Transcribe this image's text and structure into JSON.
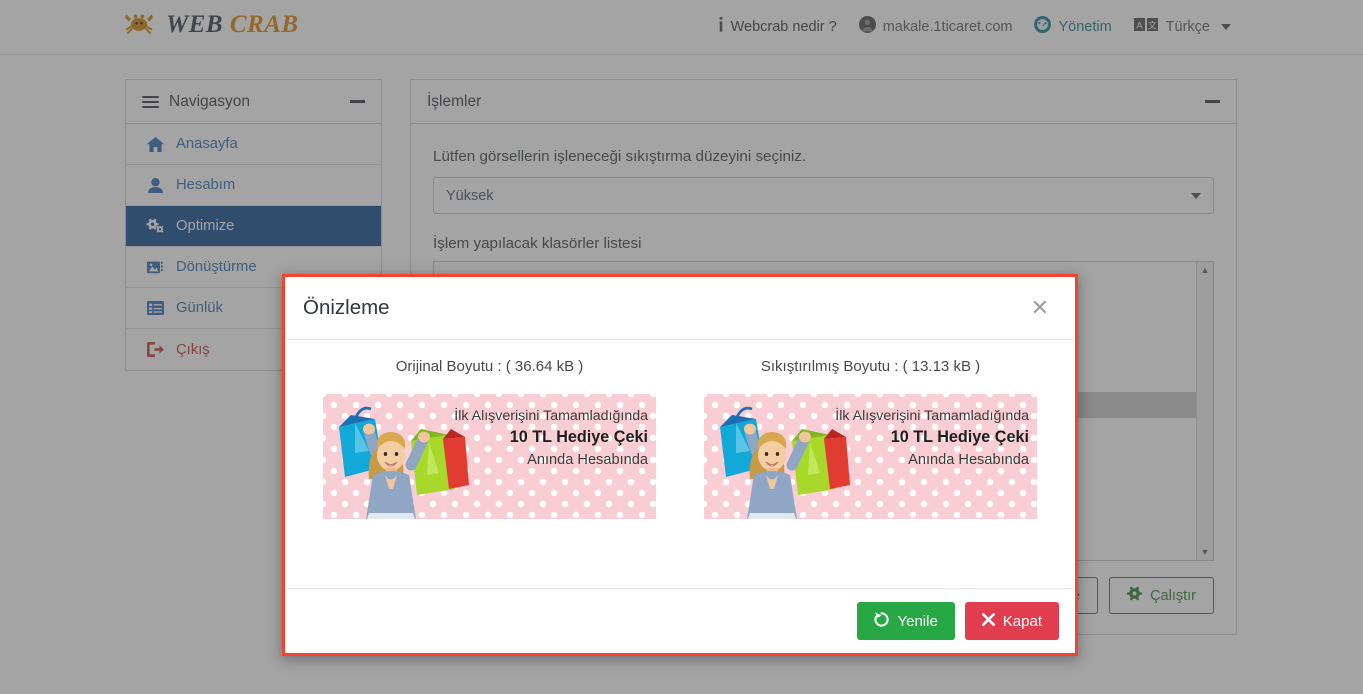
{
  "header": {
    "brand": {
      "word1": "WEB",
      "word2": "CRAB",
      "icon": "crab-icon"
    },
    "nav": [
      {
        "label": "Webcrab nedir ?",
        "icon": "info-icon",
        "style": "link"
      },
      {
        "label": "makale.1ticaret.com",
        "icon": "user-circle-icon",
        "style": "muted"
      },
      {
        "label": "Yönetim",
        "icon": "dashboard-icon",
        "style": "teal"
      },
      {
        "label": "Türkçe",
        "icon": "language-icon",
        "style": "muted",
        "caret": true
      }
    ]
  },
  "sidebar": {
    "title": "Navigasyon",
    "collapse_icon": "minus-icon",
    "menu_icon": "hamburger-icon",
    "items": [
      {
        "label": "Anasayfa",
        "icon": "home-icon",
        "active": false
      },
      {
        "label": "Hesabım",
        "icon": "user-icon",
        "active": false
      },
      {
        "label": "Optimize",
        "icon": "cogs-icon",
        "active": true
      },
      {
        "label": "Dönüştürme",
        "icon": "images-icon",
        "active": false
      },
      {
        "label": "Günlük",
        "icon": "list-alt-icon",
        "active": false
      },
      {
        "label": "Çıkış",
        "icon": "sign-out-icon",
        "active": false,
        "logout": true
      }
    ]
  },
  "main": {
    "title": "İşlemler",
    "collapse_icon": "minus-icon",
    "compression_help": "Lütfen görsellerin işleneceği sıkıştırma düzeyini seçiniz.",
    "compression_value": "Yüksek",
    "compression_caret": "chevron-down-icon",
    "folders_label": "İşlem yapılacak klasörler listesi",
    "scroll_up_icon": "triangle-up-icon",
    "scroll_down_icon": "triangle-down-icon",
    "buttons": [
      {
        "label": "Önizleme",
        "icon": "eye-icon"
      },
      {
        "label": "Çalıştır",
        "icon": "gear-icon"
      }
    ]
  },
  "modal": {
    "title": "Önizleme",
    "close_icon": "close-icon",
    "original": {
      "caption": "Orijinal Boyutu : ( 36.64 kB )",
      "banner": {
        "line1": "İlk Alışverişini Tamamladığında",
        "line2": "10 TL Hediye Çeki",
        "line3": "Anında Hesabında"
      }
    },
    "compressed": {
      "caption": "Sıkıştırılmış Boyutu : ( 13.13 kB )",
      "banner": {
        "line1": "İlk Alışverişini Tamamladığında",
        "line2": "10 TL Hediye Çeki",
        "line3": "Anında Hesabında"
      }
    },
    "buttons": [
      {
        "label": "Yenile",
        "icon": "refresh-icon",
        "color": "#28a745"
      },
      {
        "label": "Kapat",
        "icon": "times-icon",
        "color": "#e03e4e"
      }
    ]
  },
  "colors": {
    "brand_orange": "#d98400",
    "sidebar_active": "#0d4a8f",
    "link_blue": "#2d6cb5",
    "logout_red": "#c0392b",
    "modal_border": "#f4442e",
    "teal": "#12808a",
    "green": "#28a745",
    "red": "#e03e4e"
  }
}
